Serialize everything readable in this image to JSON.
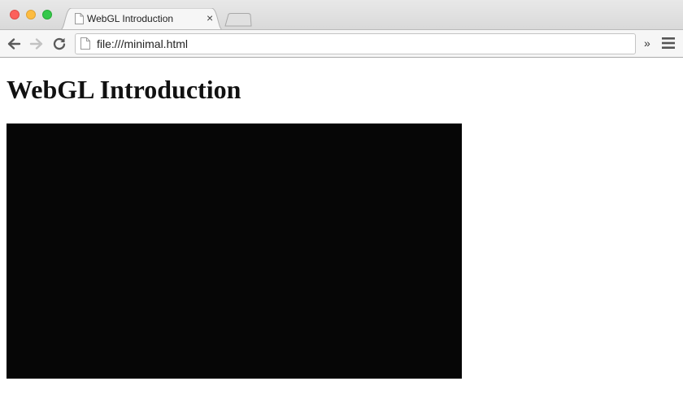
{
  "browser": {
    "tab": {
      "title": "WebGL Introduction",
      "close_glyph": "×",
      "favicon": "page-icon"
    },
    "toolbar": {
      "back_icon": "arrow-left-icon",
      "forward_icon": "arrow-right-icon",
      "reload_icon": "reload-icon",
      "url": "file:///minimal.html",
      "overflow_glyph": "»",
      "menu_icon": "hamburger-menu-icon"
    },
    "window_controls": [
      "close",
      "minimize",
      "maximize"
    ]
  },
  "page": {
    "heading": "WebGL Introduction",
    "canvas_clear_color": "#060606"
  },
  "colors": {
    "close": "#fc605c",
    "minimize": "#fdbc40",
    "maximize": "#34c84a"
  }
}
